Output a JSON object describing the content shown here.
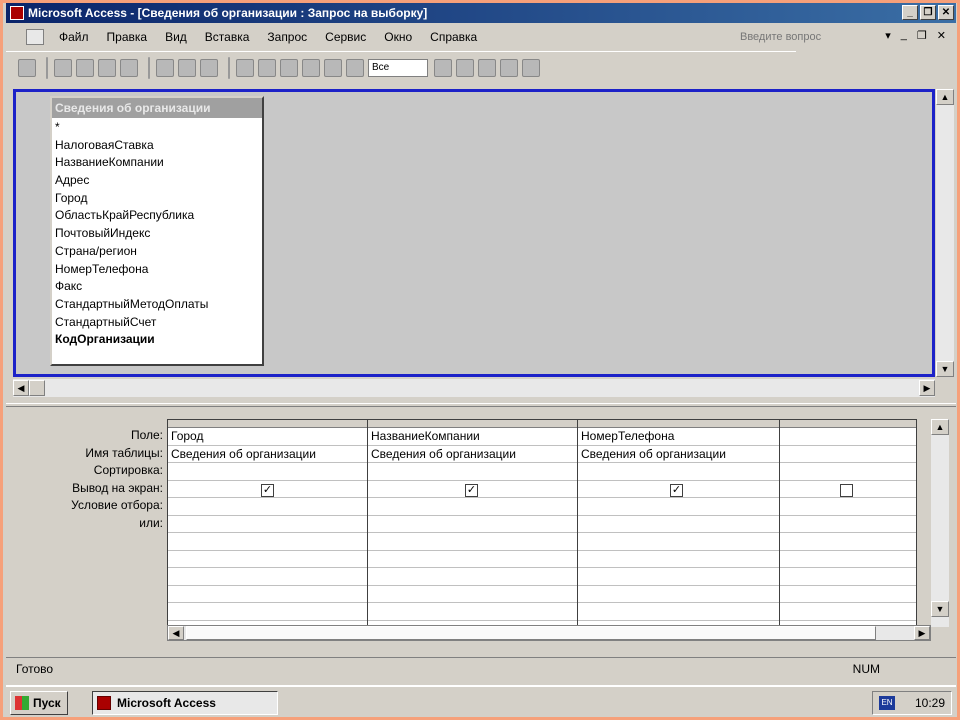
{
  "window": {
    "title": "Microsoft Access - [Сведения об организации : Запрос на выборку]",
    "minimize": "_",
    "restore": "❐",
    "close": "✕"
  },
  "menubar": {
    "items": [
      "Файл",
      "Правка",
      "Вид",
      "Вставка",
      "Запрос",
      "Сервис",
      "Окно",
      "Справка"
    ],
    "help_placeholder": "Введите вопрос",
    "mdi_buttons": [
      "▾",
      "_",
      "❐",
      "✕"
    ]
  },
  "toolbar": {
    "view_combo": "Все"
  },
  "field_list": {
    "title": "Сведения об организации",
    "items": [
      "*",
      "НалоговаяСтавка",
      "НазваниеКомпании",
      "Адрес",
      "Город",
      "ОбластьКрайРеспублика",
      "ПочтовыйИндекс",
      "Страна/регион",
      "НомерТелефона",
      "Факс",
      "СтандартныйМетодОплаты",
      "СтандартныйСчет",
      "КодОрганизации"
    ]
  },
  "qbe": {
    "row_labels": [
      "Поле:",
      "Имя таблицы:",
      "Сортировка:",
      "Вывод на экран:",
      "Условие отбора:",
      "или:"
    ],
    "columns": [
      {
        "field": "Город",
        "table": "Сведения об организации",
        "sort": "",
        "show": true
      },
      {
        "field": "НазваниеКомпании",
        "table": "Сведения об организации",
        "sort": "",
        "show": true
      },
      {
        "field": "НомерТелефона",
        "table": "Сведения об организации",
        "sort": "",
        "show": true
      },
      {
        "field": "",
        "table": "",
        "sort": "",
        "show": false
      }
    ]
  },
  "statusbar": {
    "left": "Готово",
    "right": "NUM"
  },
  "taskbar": {
    "start_label": "Пуск",
    "task_label": "Microsoft Access",
    "lang": "EN",
    "clock": "10:29"
  }
}
